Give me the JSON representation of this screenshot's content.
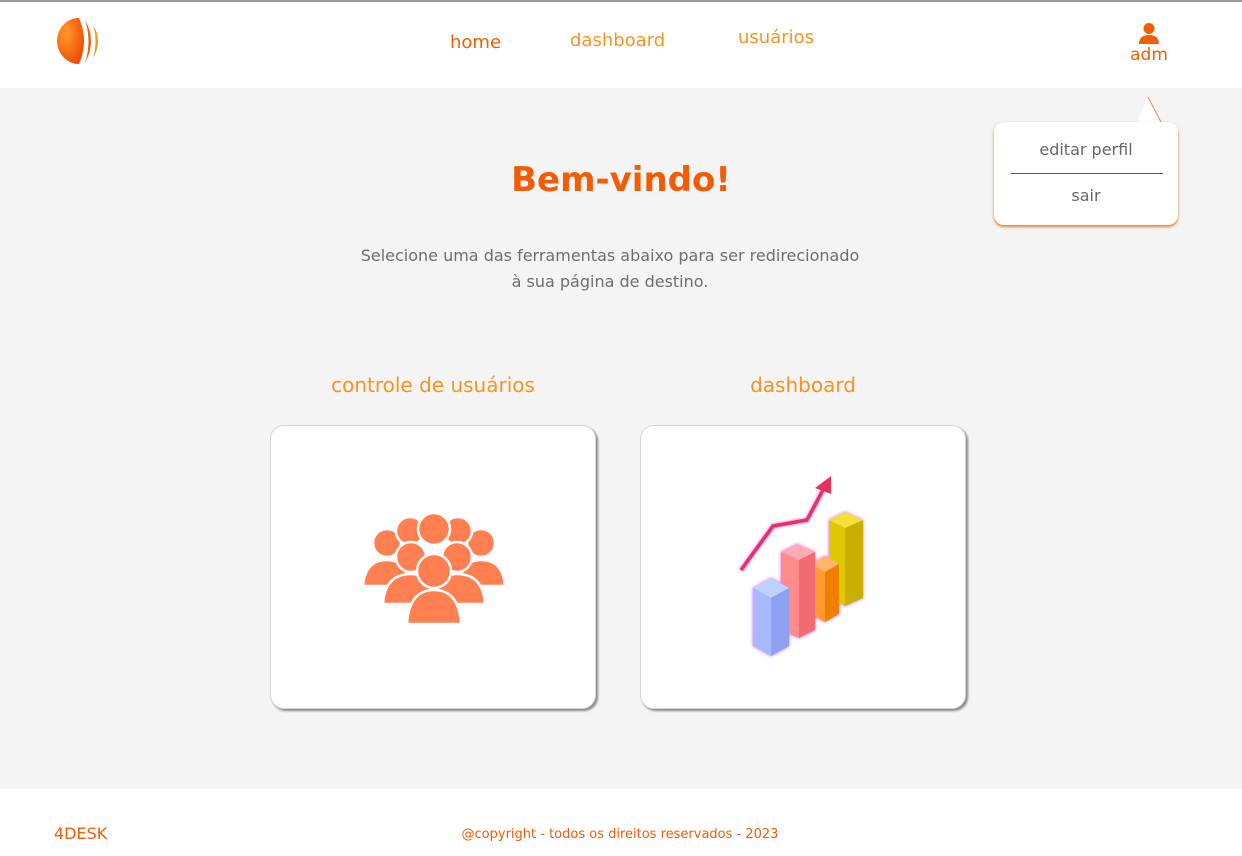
{
  "header": {
    "logo_icon": "orange-sphere-logo-icon",
    "nav": {
      "home": "home",
      "dashboard": "dashboard",
      "users": "usuários"
    },
    "user": {
      "icon": "user-icon",
      "label": "adm"
    }
  },
  "dropdown": {
    "edit_profile": "editar perfil",
    "logout": "sair"
  },
  "main": {
    "title": "Bem-vindo!",
    "subtitle_line1": "Selecione uma das ferramentas abaixo para ser redirecionado",
    "subtitle_line2": "à sua página de destino.",
    "cards": [
      {
        "title": "controle de usuários",
        "icon": "users-group-icon"
      },
      {
        "title": "dashboard",
        "icon": "bar-chart-icon"
      }
    ]
  },
  "footer": {
    "brand": "4DESK",
    "copyright": "@copyright - todos os direitos reservados - 2023"
  },
  "colors": {
    "primary": "#f25c05",
    "accent": "#f7931e",
    "background": "#f4f4f4",
    "users_icon": "#ff7f50"
  }
}
